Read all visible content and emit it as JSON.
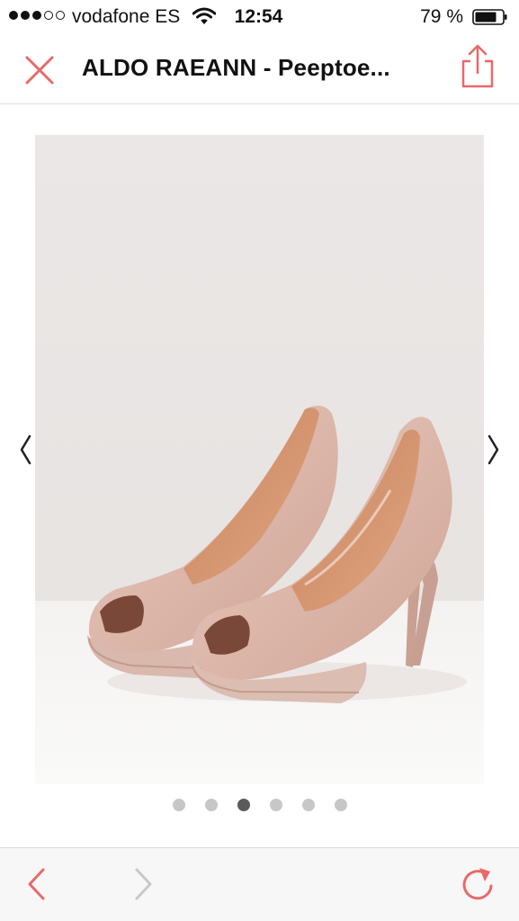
{
  "status_bar": {
    "signal_strength": "3 of 5",
    "carrier": "vodafone ES",
    "time": "12:54",
    "battery_percent": "79 %",
    "icons": [
      "signal-dots-icon",
      "wifi-icon",
      "battery-icon"
    ]
  },
  "nav": {
    "title": "ALDO RAEANN - Peeptoe...",
    "close_icon": "close-icon",
    "share_icon": "share-icon",
    "accent_color": "#e8696a"
  },
  "gallery": {
    "image_description": "product-photo",
    "prev_icon": "chevron-left-icon",
    "next_icon": "chevron-right-icon",
    "page_count": 6,
    "active_page": 3
  },
  "toolbar": {
    "back_icon": "chevron-left-icon",
    "forward_icon": "chevron-right-icon",
    "reload_icon": "reload-icon",
    "forward_enabled": false
  }
}
